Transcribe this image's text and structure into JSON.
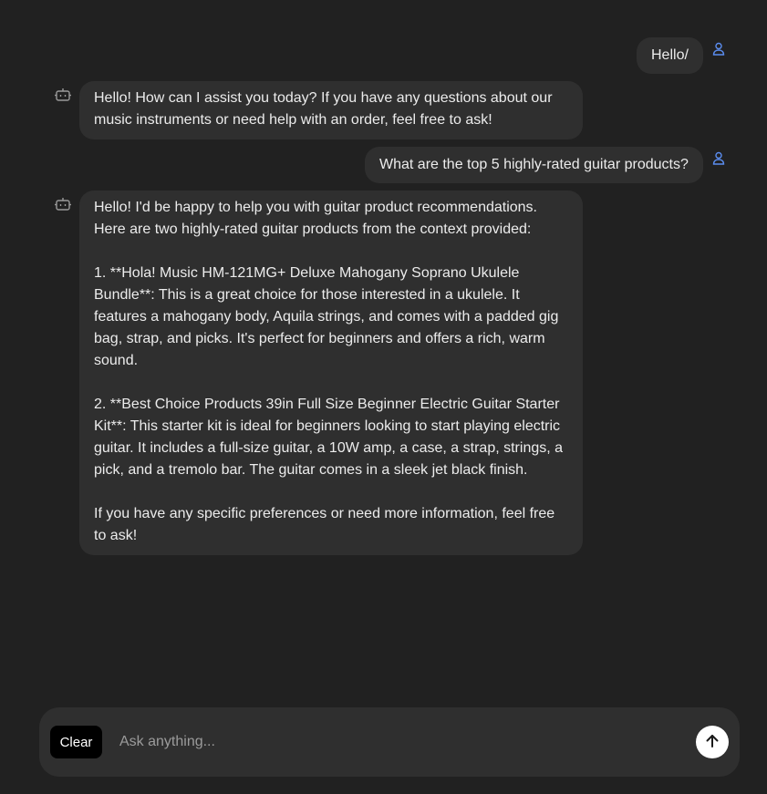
{
  "messages": [
    {
      "role": "user",
      "icon": "user-icon",
      "text": "Hello/"
    },
    {
      "role": "assistant",
      "icon": "bot-icon",
      "text": "Hello! How can I assist you today? If you have any questions about our music instruments or need help with an order, feel free to ask!"
    },
    {
      "role": "user",
      "icon": "user-icon",
      "text": "What are the top 5 highly-rated guitar products?"
    },
    {
      "role": "assistant",
      "icon": "bot-icon",
      "text": "Hello! I'd be happy to help you with guitar product recommendations. Here are two highly-rated guitar products from the context provided:\n\n1. **Hola! Music HM-121MG+ Deluxe Mahogany Soprano Ukulele Bundle**: This is a great choice for those interested in a ukulele. It features a mahogany body, Aquila strings, and comes with a padded gig bag, strap, and picks. It's perfect for beginners and offers a rich, warm sound.\n\n2. **Best Choice Products 39in Full Size Beginner Electric Guitar Starter Kit**: This starter kit is ideal for beginners looking to start playing electric guitar. It includes a full-size guitar, a 10W amp, a case, a strap, strings, a pick, and a tremolo bar. The guitar comes in a sleek jet black finish.\n\nIf you have any specific preferences or need more information, feel free to ask!"
    }
  ],
  "composer": {
    "clear_label": "Clear",
    "placeholder": "Ask anything...",
    "value": "",
    "send_icon": "arrow-up-icon"
  },
  "colors": {
    "background": "#212121",
    "bubble": "#2f2f2f",
    "user_icon": "#5b8def",
    "bot_icon": "#9a9a9a",
    "clear_button": "#000000",
    "send_button": "#ffffff"
  }
}
